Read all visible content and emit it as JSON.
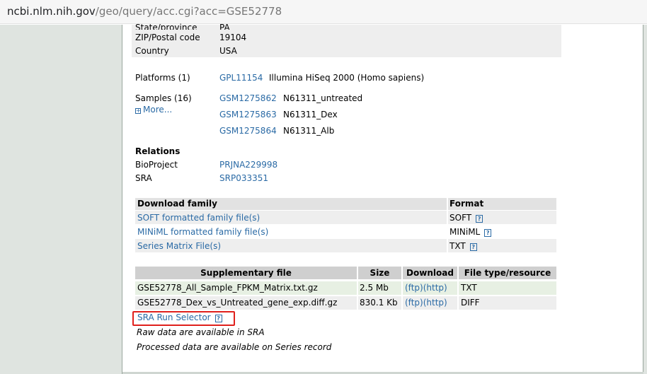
{
  "browser": {
    "url_host": "ncbi.nlm.nih.gov",
    "url_path": "/geo/query/acc.cgi?acc=GSE52778"
  },
  "contact": {
    "state_label": "State/province",
    "state_value": "PA",
    "zip_label": "ZIP/Postal code",
    "zip_value": "19104",
    "country_label": "Country",
    "country_value": "USA"
  },
  "platforms": {
    "label": "Platforms (1)",
    "id": "GPL11154",
    "desc": "Illumina HiSeq 2000 (Homo sapiens)"
  },
  "samples": {
    "label": "Samples (16)",
    "more_label": "More...",
    "items": [
      {
        "id": "GSM1275862",
        "name": "N61311_untreated"
      },
      {
        "id": "GSM1275863",
        "name": "N61311_Dex"
      },
      {
        "id": "GSM1275864",
        "name": "N61311_Alb"
      }
    ]
  },
  "relations": {
    "heading": "Relations",
    "bioproject_label": "BioProject",
    "bioproject_value": "PRJNA229998",
    "sra_label": "SRA",
    "sra_value": "SRP033351"
  },
  "download_family": {
    "header_left": "Download family",
    "header_right": "Format",
    "rows": [
      {
        "label": "SOFT formatted family file(s)",
        "format": "SOFT"
      },
      {
        "label": "MINiML formatted family file(s)",
        "format": "MINiML"
      },
      {
        "label": "Series Matrix File(s)",
        "format": "TXT"
      }
    ],
    "help_glyph": "?"
  },
  "supplementary": {
    "headers": [
      "Supplementary file",
      "Size",
      "Download",
      "File type/resource"
    ],
    "rows": [
      {
        "file": "GSE52778_All_Sample_FPKM_Matrix.txt.gz",
        "size": "2.5 Mb",
        "download": "(ftp)(http)",
        "type": "TXT"
      },
      {
        "file": "GSE52778_Dex_vs_Untreated_gene_exp.diff.gz",
        "size": "830.1 Kb",
        "download": "(ftp)(http)",
        "type": "DIFF"
      }
    ],
    "sra_run_selector": "SRA Run Selector",
    "note_raw": "Raw data are available in SRA",
    "note_processed": "Processed data are available on Series record"
  },
  "colors": {
    "link": "#2a6aa5",
    "highlight_box": "#e0201c",
    "side_panel": "#dfe4e0"
  }
}
